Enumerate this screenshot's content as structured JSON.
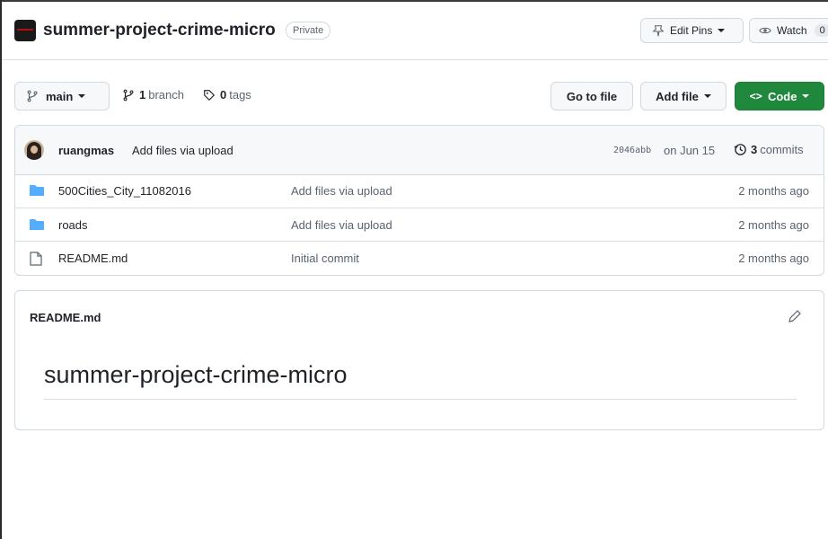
{
  "repo": {
    "name": "summer-project-crime-micro",
    "visibility": "Private",
    "edit_pins_label": "Edit Pins",
    "watch_label": "Watch",
    "watch_count": "0"
  },
  "toolbar": {
    "branch_name": "main",
    "branch_count": "1",
    "branch_label": "branch",
    "tag_count": "0",
    "tag_label": "tags",
    "go_to_file": "Go to file",
    "add_file": "Add file",
    "code": "Code"
  },
  "commit": {
    "author": "ruangmas",
    "message": "Add files via upload",
    "sha": "2046abb",
    "date": "on Jun 15",
    "commit_count": "3",
    "commits_label": "commits"
  },
  "files": [
    {
      "type": "folder",
      "name": "500Cities_City_11082016",
      "message": "Add files via upload",
      "age": "2 months ago"
    },
    {
      "type": "folder",
      "name": "roads",
      "message": "Add files via upload",
      "age": "2 months ago"
    },
    {
      "type": "file",
      "name": "README.md",
      "message": "Initial commit",
      "age": "2 months ago"
    }
  ],
  "readme": {
    "file_name": "README.md",
    "heading": "summer-project-crime-micro"
  },
  "colors": {
    "primary_button": "#1f883d",
    "folder_icon": "#54aeff",
    "border": "#d1d9e0"
  }
}
